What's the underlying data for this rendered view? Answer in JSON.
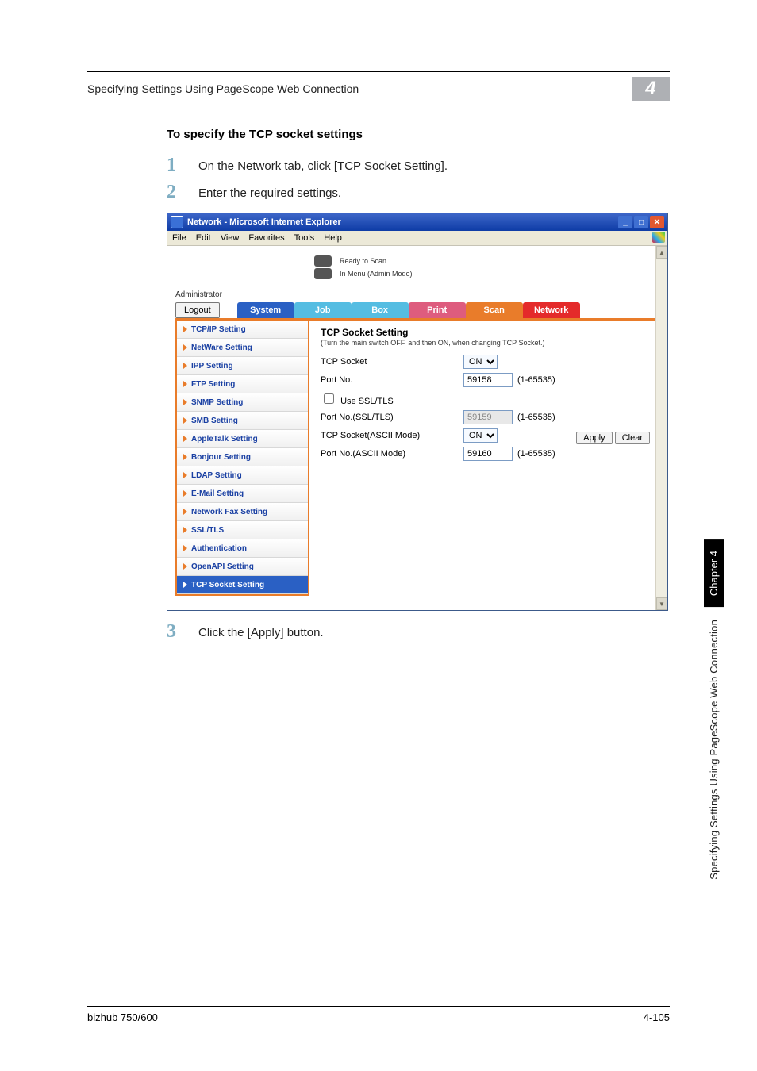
{
  "page": {
    "header_title": "Specifying Settings Using PageScope Web Connection",
    "chapter_number": "4",
    "section_heading": "To specify the TCP socket settings",
    "steps": [
      {
        "num": "1",
        "text": "On the Network tab, click [TCP Socket Setting]."
      },
      {
        "num": "2",
        "text": "Enter the required settings."
      },
      {
        "num": "3",
        "text": "Click the [Apply] button."
      }
    ],
    "side_chapter_badge": "Chapter 4",
    "side_vertical_text": "Specifying Settings Using PageScope Web Connection",
    "footer_left": "bizhub 750/600",
    "footer_right": "4-105"
  },
  "ie": {
    "title": "Network - Microsoft Internet Explorer",
    "menus": [
      "File",
      "Edit",
      "View",
      "Favorites",
      "Tools",
      "Help"
    ],
    "win_min": "_",
    "win_max": "□",
    "win_close": "✕"
  },
  "app": {
    "status_line1": "Ready to Scan",
    "status_line2": "In Menu (Admin Mode)",
    "administrator_label": "Administrator",
    "logout_label": "Logout",
    "tabs": {
      "system": "System",
      "job": "Job",
      "box": "Box",
      "print": "Print",
      "scan": "Scan",
      "network": "Network"
    },
    "sidebar": [
      "TCP/IP Setting",
      "NetWare Setting",
      "IPP Setting",
      "FTP Setting",
      "SNMP Setting",
      "SMB Setting",
      "AppleTalk Setting",
      "Bonjour Setting",
      "LDAP Setting",
      "E-Mail Setting",
      "Network Fax Setting",
      "SSL/TLS",
      "Authentication",
      "OpenAPI Setting",
      "TCP Socket Setting"
    ],
    "form": {
      "title": "TCP Socket Setting",
      "note": "(Turn the main switch OFF, and then ON, when changing TCP Socket.)",
      "rows": {
        "tcp_socket_label": "TCP Socket",
        "tcp_socket_value": "ON",
        "port_no_label": "Port No.",
        "port_no_value": "59158",
        "use_ssl_label": "Use SSL/TLS",
        "use_ssl_checked": false,
        "port_no_ssl_label": "Port No.(SSL/TLS)",
        "port_no_ssl_value": "59159",
        "tcp_ascii_label": "TCP Socket(ASCII Mode)",
        "tcp_ascii_value": "ON",
        "port_no_ascii_label": "Port No.(ASCII Mode)",
        "port_no_ascii_value": "59160",
        "range": "(1-65535)"
      },
      "apply_label": "Apply",
      "clear_label": "Clear"
    }
  }
}
